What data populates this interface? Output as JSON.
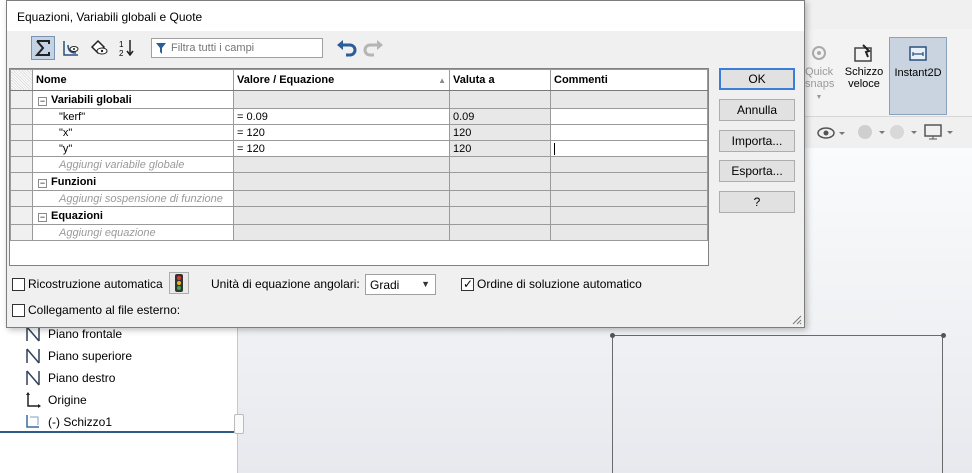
{
  "dialog": {
    "title": "Equazioni, Variabili globali e Quote",
    "toolbar": {
      "icons": [
        "sigma-icon",
        "dimension-view-icon",
        "equations-view-icon",
        "sort-order-icon",
        "undo-icon",
        "redo-icon"
      ],
      "filter_placeholder": "Filtra tutti i campi"
    },
    "grid": {
      "columns": [
        "Nome",
        "Valore / Equazione",
        "Valuta a",
        "Commenti"
      ],
      "sections": [
        {
          "name": "Variabili globali",
          "rows": [
            {
              "name": "\"kerf\"",
              "value": "= 0.09",
              "eval": "0.09",
              "comment": ""
            },
            {
              "name": "\"x\"",
              "value": "= 120",
              "eval": "120",
              "comment": ""
            },
            {
              "name": "\"y\"",
              "value": "= 120",
              "eval": "120",
              "comment": ""
            }
          ],
          "add_label": "Aggiungi variabile globale"
        },
        {
          "name": "Funzioni",
          "rows": [],
          "add_label": "Aggiungi sospensione di funzione"
        },
        {
          "name": "Equazioni",
          "rows": [],
          "add_label": "Aggiungi equazione"
        }
      ]
    },
    "buttons": {
      "ok": "OK",
      "cancel": "Annulla",
      "import": "Importa...",
      "export": "Esporta...",
      "help": "?"
    },
    "bottom": {
      "auto_rebuild": {
        "label": "Ricostruzione automatica",
        "checked": false
      },
      "angular_units_label": "Unità di equazione angolari:",
      "angular_units_value": "Gradi",
      "auto_solve_order": {
        "label": "Ordine di soluzione automatico",
        "checked": true
      },
      "external_link": {
        "label": "Collegamento al file esterno:",
        "checked": false
      }
    }
  },
  "background": {
    "command_manager": {
      "quick_snaps": "Quick\nsnaps",
      "schizzo_veloce": "Schizzo\nveloce",
      "instant2d": "Instant2D"
    },
    "feature_tree": [
      {
        "label": "Piano frontale",
        "icon": "plane-icon"
      },
      {
        "label": "Piano superiore",
        "icon": "plane-icon"
      },
      {
        "label": "Piano destro",
        "icon": "plane-icon"
      },
      {
        "label": "Origine",
        "icon": "origin-icon"
      },
      {
        "label": "(-) Schizzo1",
        "icon": "sketch-icon"
      }
    ]
  },
  "colors": {
    "accent": "#3b7dd8",
    "active_button": "#c4d3e3",
    "gray_cell": "#e8e8e8"
  }
}
